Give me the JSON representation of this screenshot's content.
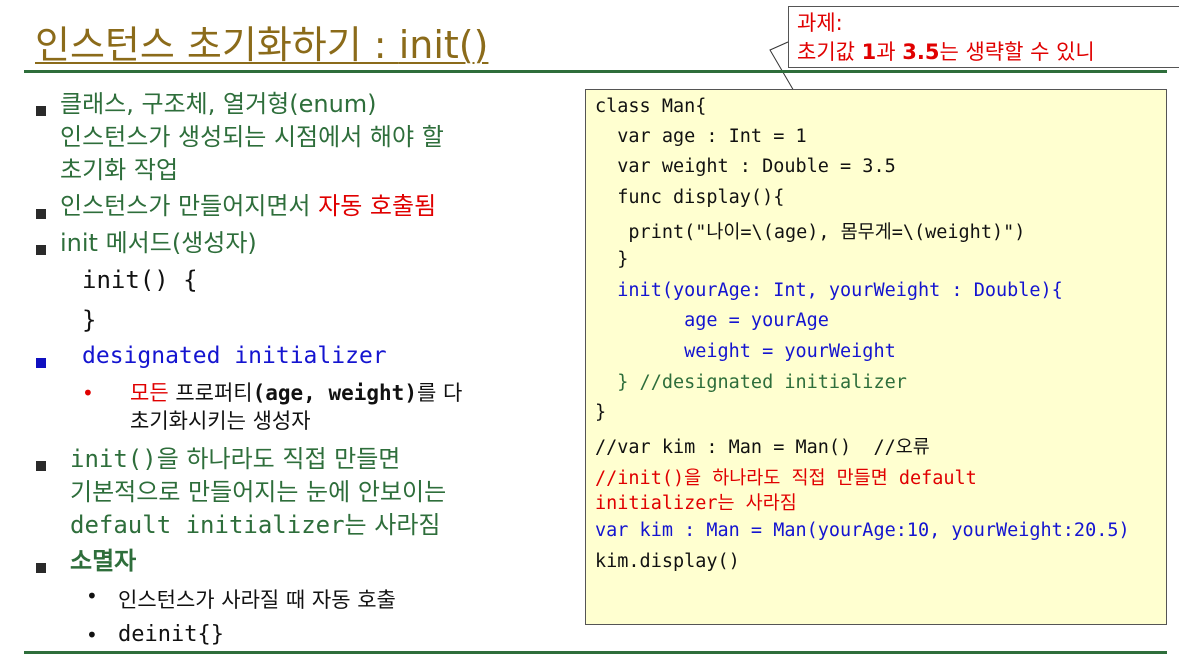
{
  "title": {
    "main": "인스턴스 초기화하기 : ",
    "code": "init()"
  },
  "task": {
    "label": "과제:",
    "line_pre": "초기값 ",
    "num1": "1",
    "mid": "과 ",
    "num2": "3.5",
    "line_post": "는 생략할 수 있니"
  },
  "left": {
    "b1": {
      "line1": "클래스, 구조체, 열거형(enum)",
      "line2": "인스턴스가 생성되는 시점에서 해야 할",
      "line3": "초기화 작업"
    },
    "b2": {
      "text": "인스턴스가 만들어지면서 ",
      "highlight": "자동 호출됨"
    },
    "b3": {
      "text": "init 메서드(생성자)",
      "code1": "init() {",
      "code2": "}"
    },
    "b4": {
      "text": "designated initializer"
    },
    "b4_sub": {
      "red": "모든",
      "rest1": " 프로퍼티",
      "code": "(age, weight)",
      "rest2": "를 다",
      "line2": "초기화시키는 생성자"
    },
    "b5": {
      "code1": "init()",
      "text1": "을 하나라도 직접 만들면",
      "line2": "기본적으로 만들어지는 눈에 안보이는",
      "code2": "default initializer",
      "text2": "는 사라짐"
    },
    "b6": {
      "text": "소멸자",
      "sub1": "인스턴스가 사라질 때 자동 호출",
      "sub2": "deinit{}"
    }
  },
  "code": {
    "lines": [
      "class Man{",
      "  var age : Int = 1",
      "  var weight : Double = 3.5",
      "  func display(){",
      "   print(\"나이=\\(age), 몸무게=\\(weight)\")",
      "  }",
      "  init(yourAge: Int, yourWeight : Double){",
      "        age = yourAge",
      "        weight = yourWeight",
      "  } //designated initializer",
      "}",
      "//var kim : Man = Man()  //오류",
      "//init()을 하나라도 직접 만들면 default",
      "initializer는 사라짐",
      "var kim : Man = Man(yourAge:10, yourWeight:20.5)",
      "kim.display()"
    ]
  },
  "colors": {
    "title": "#8b6b1a",
    "green": "#2e6e3b",
    "red": "#e00000",
    "blue": "#1414d0",
    "code_bg": "#ffffd0"
  }
}
